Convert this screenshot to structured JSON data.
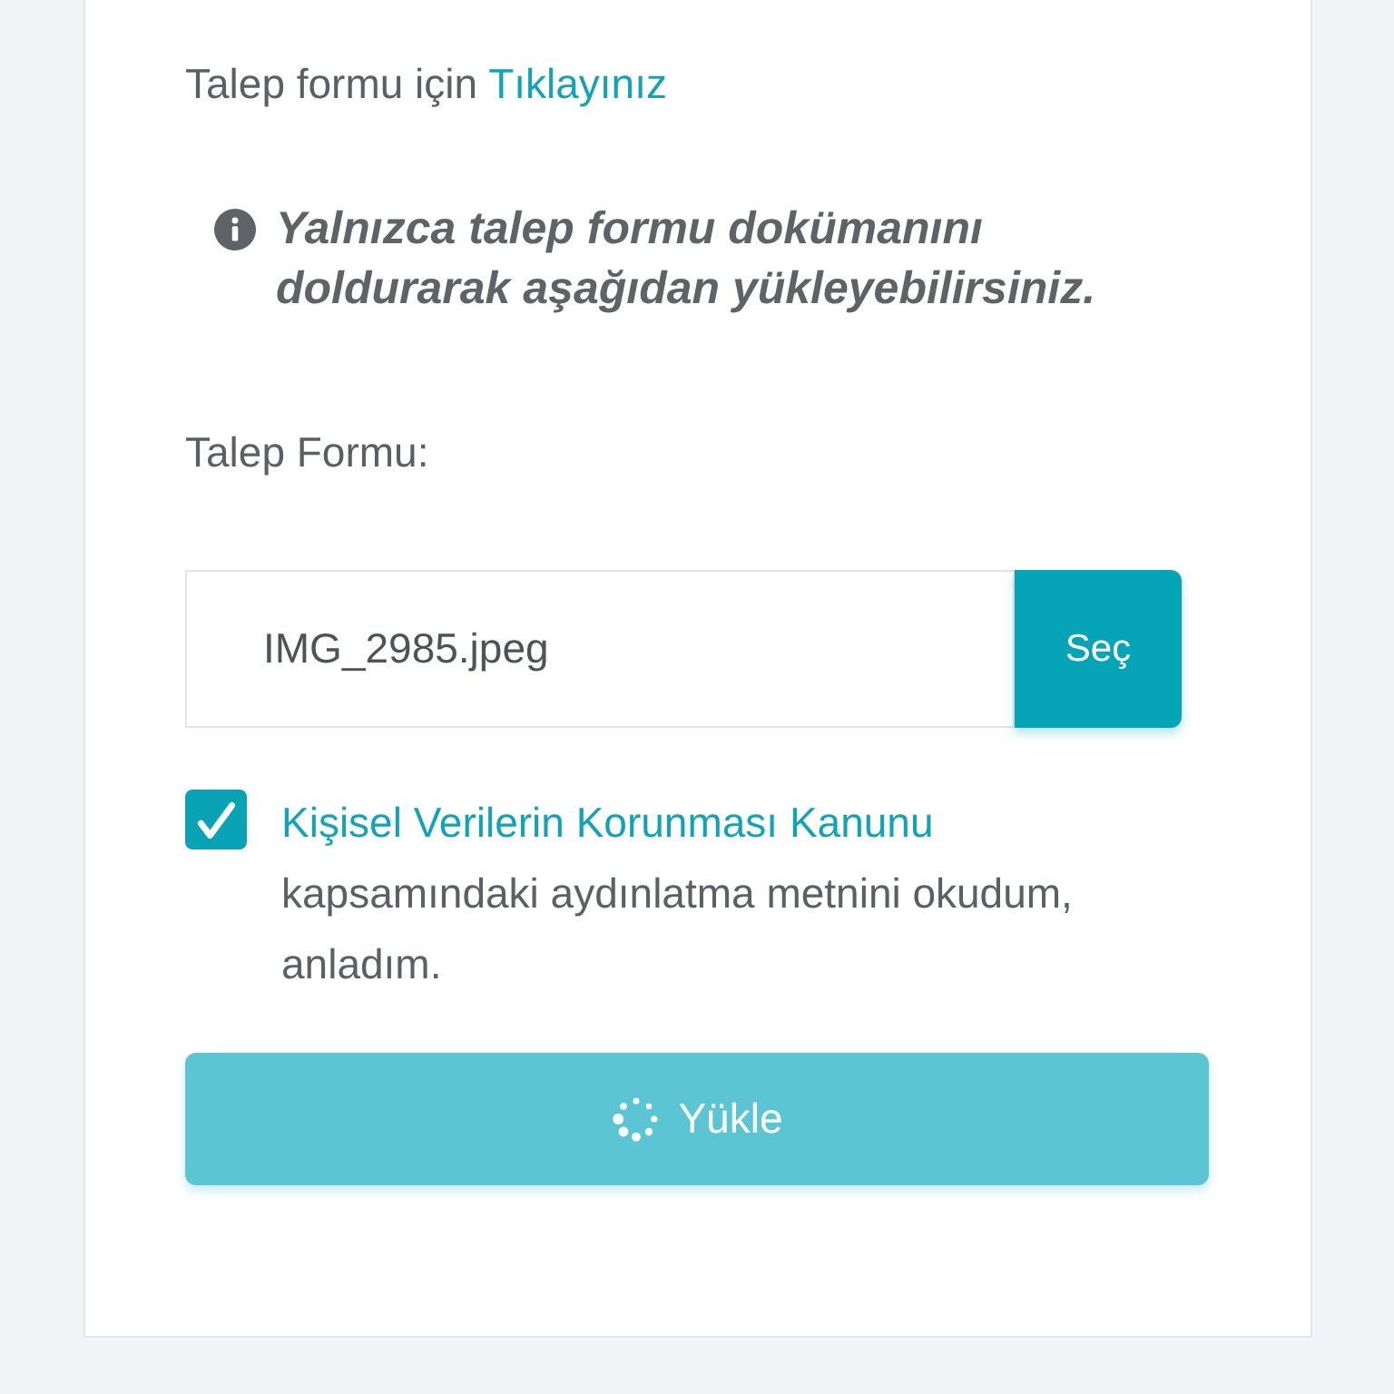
{
  "intro": {
    "text": "Talep formu için",
    "link": "Tıklayınız"
  },
  "notice": {
    "kind": "info",
    "text": "Yalnızca talep formu dokümanını doldurarak aşağıdan yükleyebilirsiniz."
  },
  "file_field": {
    "label": "Talep Formu:",
    "value": "IMG_2985.jpeg",
    "button": "Seç"
  },
  "consent": {
    "checked": true,
    "link": "Kişisel Verilerin Korunması Kanunu",
    "text": "kapsamındaki aydınlatma metnini okudum, anladım."
  },
  "upload_button": {
    "label": "Yükle",
    "loading": true
  }
}
